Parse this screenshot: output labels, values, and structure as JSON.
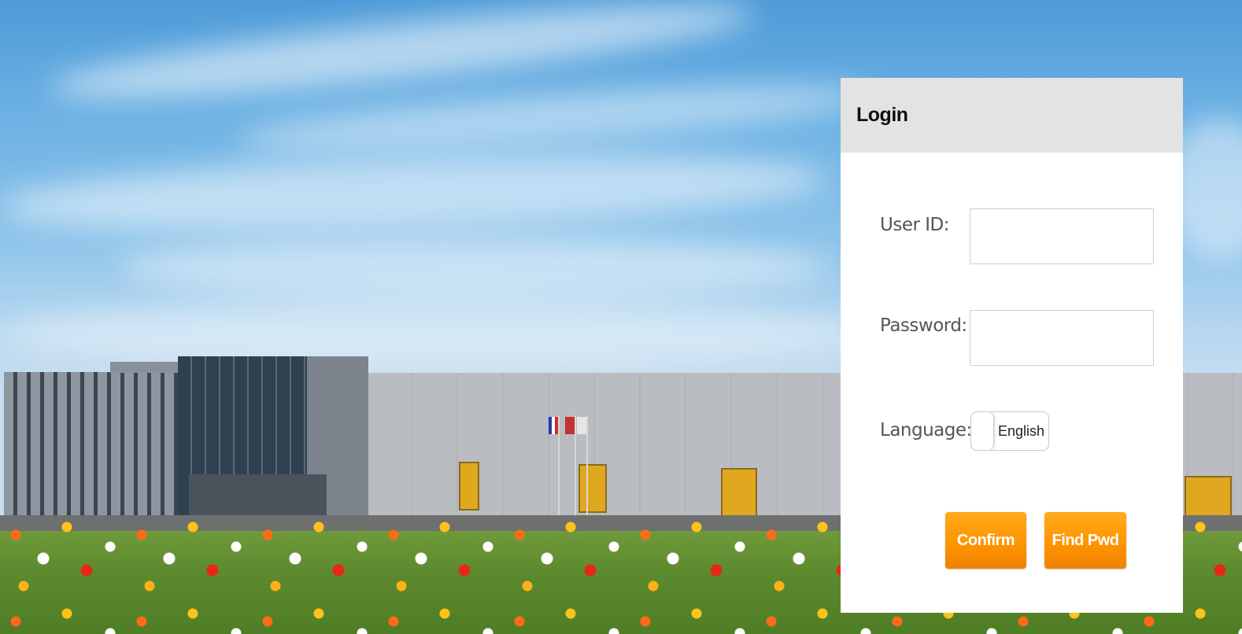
{
  "login": {
    "title": "Login",
    "user_id_label": "User ID:",
    "user_id_value": "",
    "password_label": "Password:",
    "password_value": "",
    "language_label": "Language:",
    "language_value": "English",
    "confirm_label": "Confirm",
    "find_pwd_label": "Find Pwd"
  },
  "colors": {
    "header_bg": "#e3e3e3",
    "button_accent": "#ff9400"
  }
}
